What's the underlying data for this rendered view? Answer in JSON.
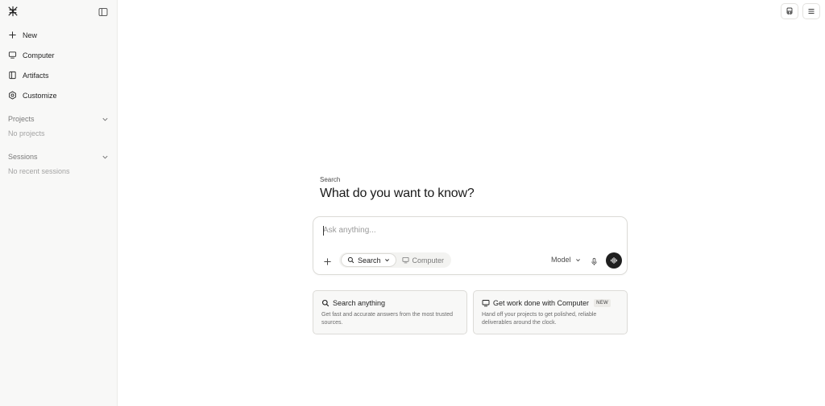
{
  "sidebar": {
    "nav": [
      {
        "label": "New",
        "icon": "plus-icon"
      },
      {
        "label": "Computer",
        "icon": "computer-icon"
      },
      {
        "label": "Artifacts",
        "icon": "book-icon"
      },
      {
        "label": "Customize",
        "icon": "customize-icon"
      }
    ],
    "projects": {
      "title": "Projects",
      "empty": "No projects"
    },
    "sessions": {
      "title": "Sessions",
      "empty": "No recent sessions"
    }
  },
  "main": {
    "eyebrow": "Search",
    "headline": "What do you want to know?",
    "composer": {
      "placeholder": "Ask anything...",
      "modes": [
        {
          "label": "Search",
          "icon": "search-icon",
          "active": true
        },
        {
          "label": "Computer",
          "icon": "computer-icon",
          "active": false
        }
      ],
      "model_label": "Model"
    },
    "cards": [
      {
        "title": "Search anything",
        "description": "Get fast and accurate answers from the most trusted sources.",
        "icon": "search-icon",
        "badge": ""
      },
      {
        "title": "Get work done with Computer",
        "description": "Hand off your projects to get polished, reliable deliverables around the clock.",
        "icon": "computer-icon",
        "badge": "NEW"
      }
    ]
  },
  "colors": {
    "sidebar_bg": "#f8f8f7",
    "accent_dark": "#1f1f1f",
    "muted_text": "#a3a3a3"
  }
}
